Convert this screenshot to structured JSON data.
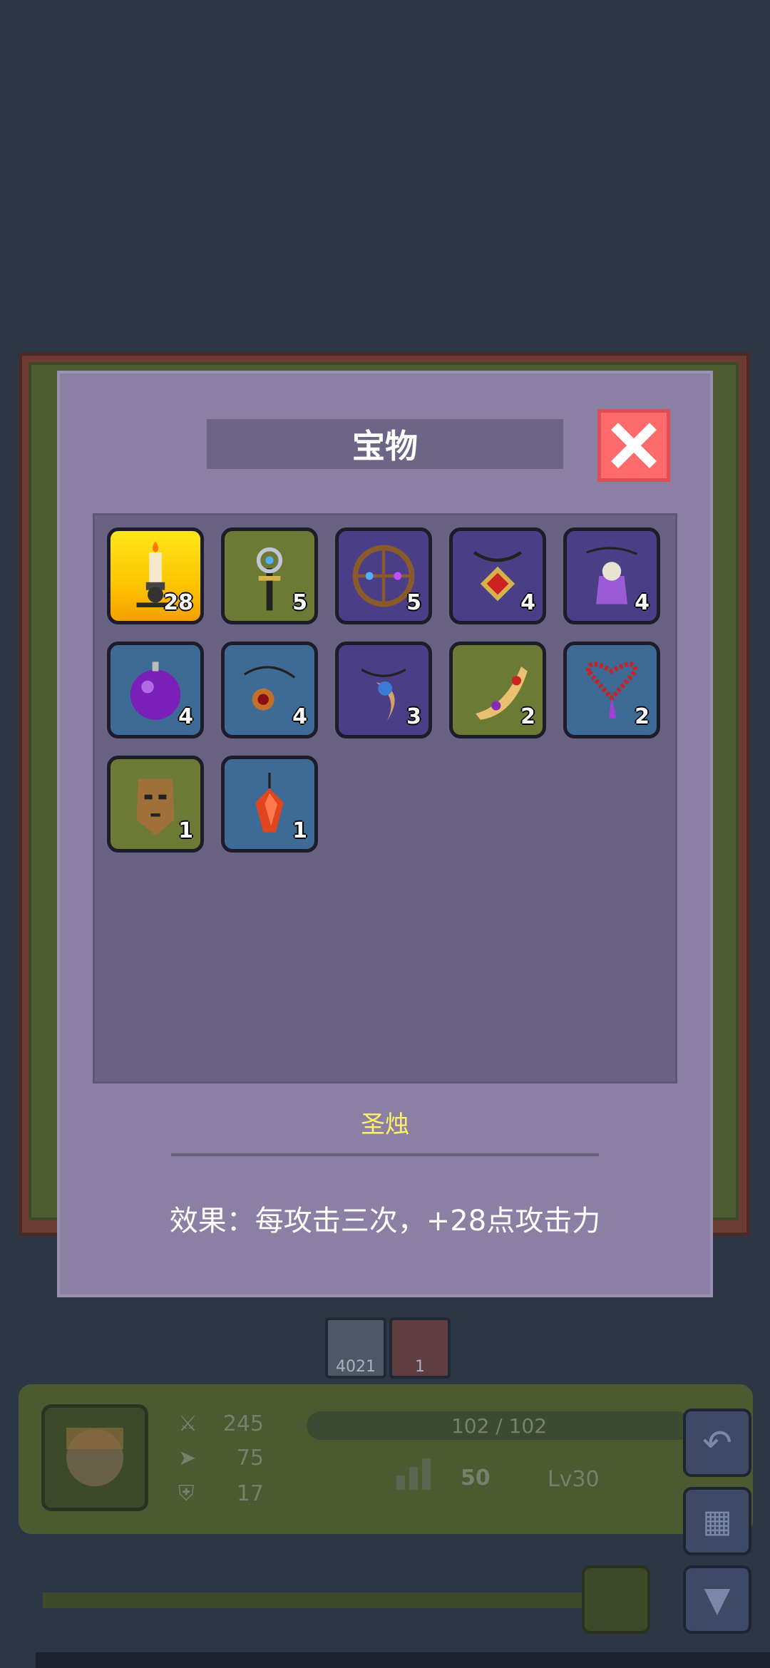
{
  "modal": {
    "title": "宝物",
    "close_icon": "close-x-icon"
  },
  "items": [
    {
      "name": "holy-candle",
      "count": "28",
      "bg": "gold",
      "icon": "candle-icon"
    },
    {
      "name": "cross-scepter",
      "count": "5",
      "bg": "green",
      "icon": "scepter-icon"
    },
    {
      "name": "round-wheel",
      "count": "5",
      "bg": "purple",
      "icon": "wheel-icon"
    },
    {
      "name": "diamond-amulet",
      "count": "4",
      "bg": "purple",
      "icon": "amulet-icon"
    },
    {
      "name": "skull-bottle",
      "count": "4",
      "bg": "purple",
      "icon": "skull-pendant-icon"
    },
    {
      "name": "purple-orb",
      "count": "4",
      "bg": "blue",
      "icon": "orb-icon"
    },
    {
      "name": "red-gem-necklace",
      "count": "4",
      "bg": "blue",
      "icon": "necklace-icon"
    },
    {
      "name": "blue-eye-fang",
      "count": "3",
      "bg": "purple",
      "icon": "fang-pendant-icon"
    },
    {
      "name": "golden-gem-boomerang",
      "count": "2",
      "bg": "green",
      "icon": "boomerang-icon"
    },
    {
      "name": "bead-necklace",
      "count": "2",
      "bg": "blue",
      "icon": "bead-necklace-icon"
    },
    {
      "name": "tribal-mask",
      "count": "1",
      "bg": "green",
      "icon": "mask-icon"
    },
    {
      "name": "red-crystal",
      "count": "1",
      "bg": "blue",
      "icon": "crystal-icon"
    }
  ],
  "selected": {
    "name": "圣烛",
    "effect": "效果：每攻击三次，+28点攻击力"
  },
  "hud": {
    "card_counts": [
      "4021",
      "1"
    ],
    "attack": "245",
    "speed": "75",
    "defense": "17",
    "hp": "102 / 102",
    "power": "50",
    "level": "Lv30"
  },
  "colors": {
    "background": "#2d3645",
    "modal": "#8b80a3",
    "close": "#ff6a6a",
    "selected_text": "#fff066"
  }
}
